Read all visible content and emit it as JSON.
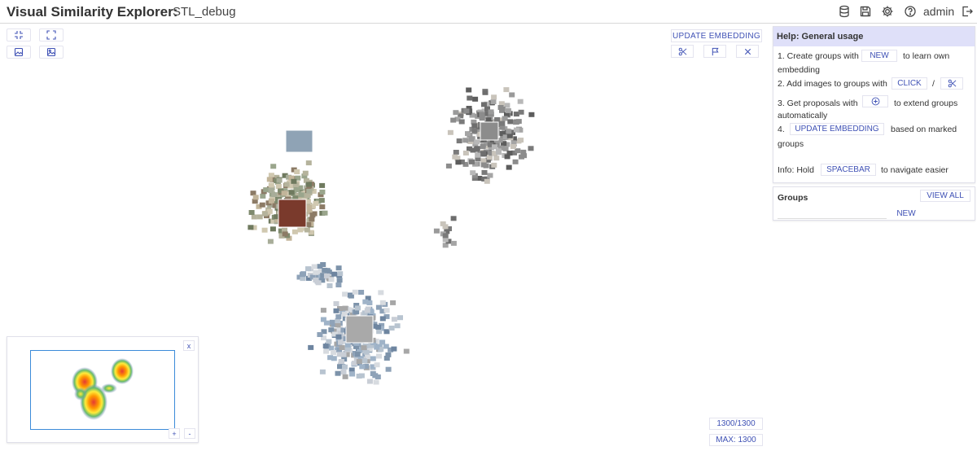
{
  "header": {
    "app_title": "Visual Similarity Explorer:",
    "dataset_name": "STL_debug",
    "user": "admin",
    "icons": [
      "database-icon",
      "save-icon",
      "settings-icon",
      "help-icon",
      "logout-icon"
    ]
  },
  "canvas_controls": {
    "update_embedding": "UPDATE EMBEDDING",
    "tools": [
      "scissors-icon",
      "flag-icon",
      "close-icon"
    ],
    "view_buttons": [
      "collapse-icon",
      "expand-icon",
      "image-icon",
      "image-alt-icon"
    ]
  },
  "help": {
    "title": "Help: General usage",
    "step1_pre": "1. Create groups with",
    "step1_chip": "NEW",
    "step1_post": "to learn own",
    "step1_cont": "embedding",
    "step2_pre": "2. Add images to groups with",
    "step2_chip": "CLICK",
    "step2_sep": "/",
    "step3_pre": "3. Get proposals with",
    "step3_post": "to extend groups",
    "step3_cont": "automatically",
    "step4_pre": "4.",
    "step4_chip": "UPDATE EMBEDDING",
    "step4_post": "based on marked",
    "step4_cont": "groups",
    "info_pre": "Info: Hold",
    "info_chip": "SPACEBAR",
    "info_post": "to navigate easier"
  },
  "groups": {
    "title": "Groups",
    "view_all": "VIEW ALL",
    "new": "NEW"
  },
  "minimap": {
    "close": "x",
    "zoom_in": "+",
    "zoom_out": "-"
  },
  "counters": {
    "shown": "1300/1300",
    "max": "MAX: 1300"
  },
  "colors": {
    "accent": "#3f51b5",
    "help_header": "#dfe0f9",
    "minimap_frame": "#3c8bd9"
  }
}
